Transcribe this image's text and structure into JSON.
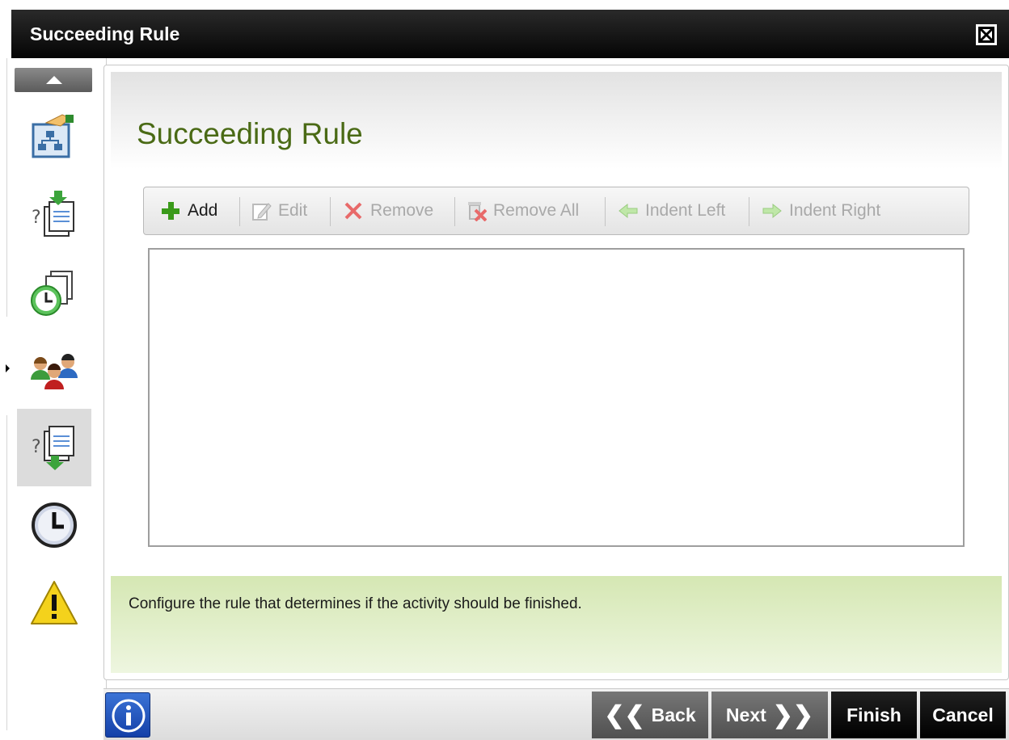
{
  "window": {
    "title": "Succeeding Rule"
  },
  "page": {
    "title": "Succeeding Rule"
  },
  "toolbar": {
    "add_label": "Add",
    "edit_label": "Edit",
    "remove_label": "Remove",
    "remove_all_label": "Remove All",
    "indent_left_label": "Indent Left",
    "indent_right_label": "Indent Right"
  },
  "info": {
    "text": "Configure the rule that determines if the activity should be finished."
  },
  "footer": {
    "back_label": "Back",
    "next_label": "Next",
    "finish_label": "Finish",
    "cancel_label": "Cancel"
  },
  "sidebar": {
    "items": [
      {
        "icon": "workflow-hand-icon"
      },
      {
        "icon": "preceding-rule-icon"
      },
      {
        "icon": "clock-documents-icon"
      },
      {
        "icon": "participants-icon"
      },
      {
        "icon": "succeeding-rule-icon"
      },
      {
        "icon": "clock-icon"
      },
      {
        "icon": "warning-icon"
      }
    ],
    "active_index": 4
  },
  "colors": {
    "title_green": "#4a6a15",
    "info_green": "#d5e7b3",
    "add_green": "#3a9a1a",
    "remove_red": "#e04040"
  }
}
